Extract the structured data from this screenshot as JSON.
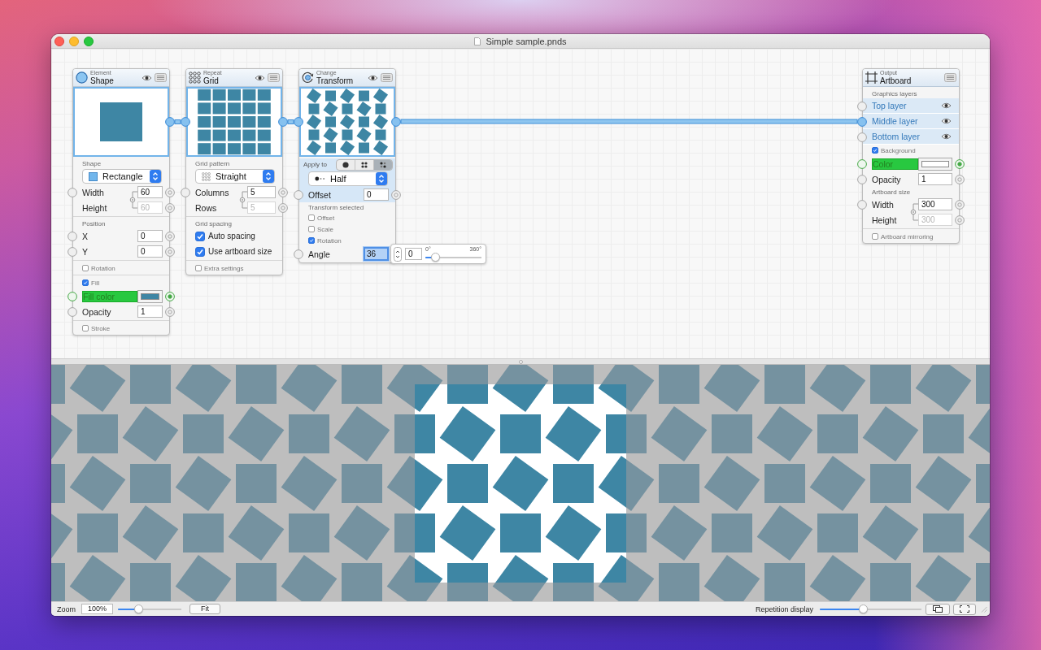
{
  "window": {
    "title": "Simple sample.pnds"
  },
  "nodes": [
    {
      "kind": "shape",
      "category": "Element",
      "title": "Shape",
      "eye_toggle": true,
      "out_linked": true,
      "sections": [
        [
          {
            "kind": "label",
            "text": "Shape"
          },
          {
            "kind": "dropdown",
            "value": "Rectangle",
            "highlighted": false
          },
          {
            "kind": "linked",
            "fields": [
              {
                "label": "Width",
                "value": "60",
                "disabled": false,
                "in_port": true,
                "out_port": true
              },
              {
                "label": "Height",
                "value": "60",
                "disabled": true,
                "in_port": false,
                "out_port": true
              }
            ]
          }
        ],
        [
          {
            "kind": "label",
            "text": "Position"
          },
          {
            "kind": "field",
            "label": "X",
            "value": "0",
            "highlighted": false,
            "focused": false,
            "in_port": true,
            "out_port": true
          },
          {
            "kind": "field",
            "label": "Y",
            "value": "0",
            "highlighted": false,
            "focused": false,
            "in_port": true,
            "out_port": true
          }
        ],
        [
          {
            "kind": "option",
            "label": "Rotation",
            "checked": false
          }
        ],
        [
          {
            "kind": "option",
            "label": "Fill",
            "checked": true
          },
          {
            "kind": "color",
            "label": "Fill color",
            "color": "#3e86a4",
            "in_port": true,
            "out_port": true
          },
          {
            "kind": "field",
            "label": "Opacity",
            "value": "1",
            "highlighted": false,
            "focused": false,
            "in_port": true,
            "out_port": true
          }
        ],
        [
          {
            "kind": "option",
            "label": "Stroke",
            "checked": false
          }
        ]
      ]
    },
    {
      "kind": "grid",
      "category": "Repeat",
      "title": "Grid",
      "eye_toggle": true,
      "in_linked": true,
      "out_linked": true,
      "sections": [
        [
          {
            "kind": "label",
            "text": "Grid pattern"
          },
          {
            "kind": "dropdown",
            "value": "Straight",
            "highlighted": false
          },
          {
            "kind": "linked",
            "fields": [
              {
                "label": "Columns",
                "value": "5",
                "disabled": false,
                "in_port": true,
                "out_port": true
              },
              {
                "label": "Rows",
                "value": "5",
                "disabled": true,
                "in_port": false,
                "out_port": true
              }
            ]
          }
        ],
        [
          {
            "kind": "label",
            "text": "Grid spacing"
          },
          {
            "kind": "checkbox",
            "label": "Auto spacing",
            "checked": true
          },
          {
            "kind": "checkbox",
            "label": "Use artboard size",
            "checked": true
          }
        ],
        [
          {
            "kind": "option",
            "label": "Extra settings",
            "checked": false
          }
        ]
      ]
    },
    {
      "kind": "transform",
      "category": "Change",
      "title": "Transform",
      "eye_toggle": true,
      "in_linked": true,
      "out_linked": true,
      "sections": [
        [
          {
            "kind": "segmented",
            "label": "Apply to",
            "highlighted": true,
            "segments": [
              {
                "kind": "dot",
                "selected": false
              },
              {
                "kind": "grid",
                "selected": false
              },
              {
                "kind": "checker",
                "selected": true
              }
            ]
          },
          {
            "kind": "dropdown",
            "value": "Half",
            "highlighted": true
          },
          {
            "kind": "field",
            "label": "Offset",
            "value": "0",
            "highlighted": true,
            "focused": false,
            "in_port": true,
            "out_port": true
          },
          {
            "kind": "label",
            "text": "Transform selected"
          },
          {
            "kind": "option",
            "label": "Offset",
            "checked": false
          },
          {
            "kind": "option",
            "label": "Scale",
            "checked": false
          },
          {
            "kind": "option",
            "label": "Rotation",
            "checked": true
          },
          {
            "kind": "field",
            "label": "Angle",
            "value": "36",
            "highlighted": false,
            "focused": true,
            "in_port": true,
            "out_port": false,
            "popover": {
              "value": "0",
              "min_label": "0°",
              "max_label": "360°",
              "level": 0.12
            }
          }
        ]
      ]
    },
    {
      "kind": "artboard",
      "category": "Output",
      "title": "Artboard",
      "eye_toggle": false,
      "sections": [
        [
          {
            "kind": "label",
            "text": "Graphics layers"
          },
          {
            "kind": "layer",
            "label": "Top layer",
            "linked": false
          },
          {
            "kind": "layer",
            "label": "Middle layer",
            "linked": true
          },
          {
            "kind": "layer",
            "label": "Bottom layer",
            "linked": false
          },
          {
            "kind": "option",
            "label": "Background",
            "checked": true
          },
          {
            "kind": "color",
            "label": "Color",
            "color": "#ffffff",
            "in_port": true,
            "out_port": true
          },
          {
            "kind": "field",
            "label": "Opacity",
            "value": "1",
            "highlighted": false,
            "focused": false,
            "in_port": true,
            "out_port": true
          },
          {
            "kind": "label",
            "text": "Artboard size"
          },
          {
            "kind": "linked",
            "fields": [
              {
                "label": "Width",
                "value": "300",
                "disabled": false,
                "in_port": true,
                "out_port": true
              },
              {
                "label": "Height",
                "value": "300",
                "disabled": true,
                "in_port": false,
                "out_port": true
              }
            ]
          }
        ],
        [
          {
            "kind": "option",
            "label": "Artboard mirroring",
            "checked": false
          }
        ]
      ]
    }
  ],
  "status_bar": {
    "zoom_label": "Zoom",
    "zoom_value": "100%",
    "zoom_slider": {
      "level": 0.3
    },
    "fit_button": "Fit",
    "repetition_label": "Repetition display",
    "repetition_slider": {
      "level": 0.42
    }
  }
}
